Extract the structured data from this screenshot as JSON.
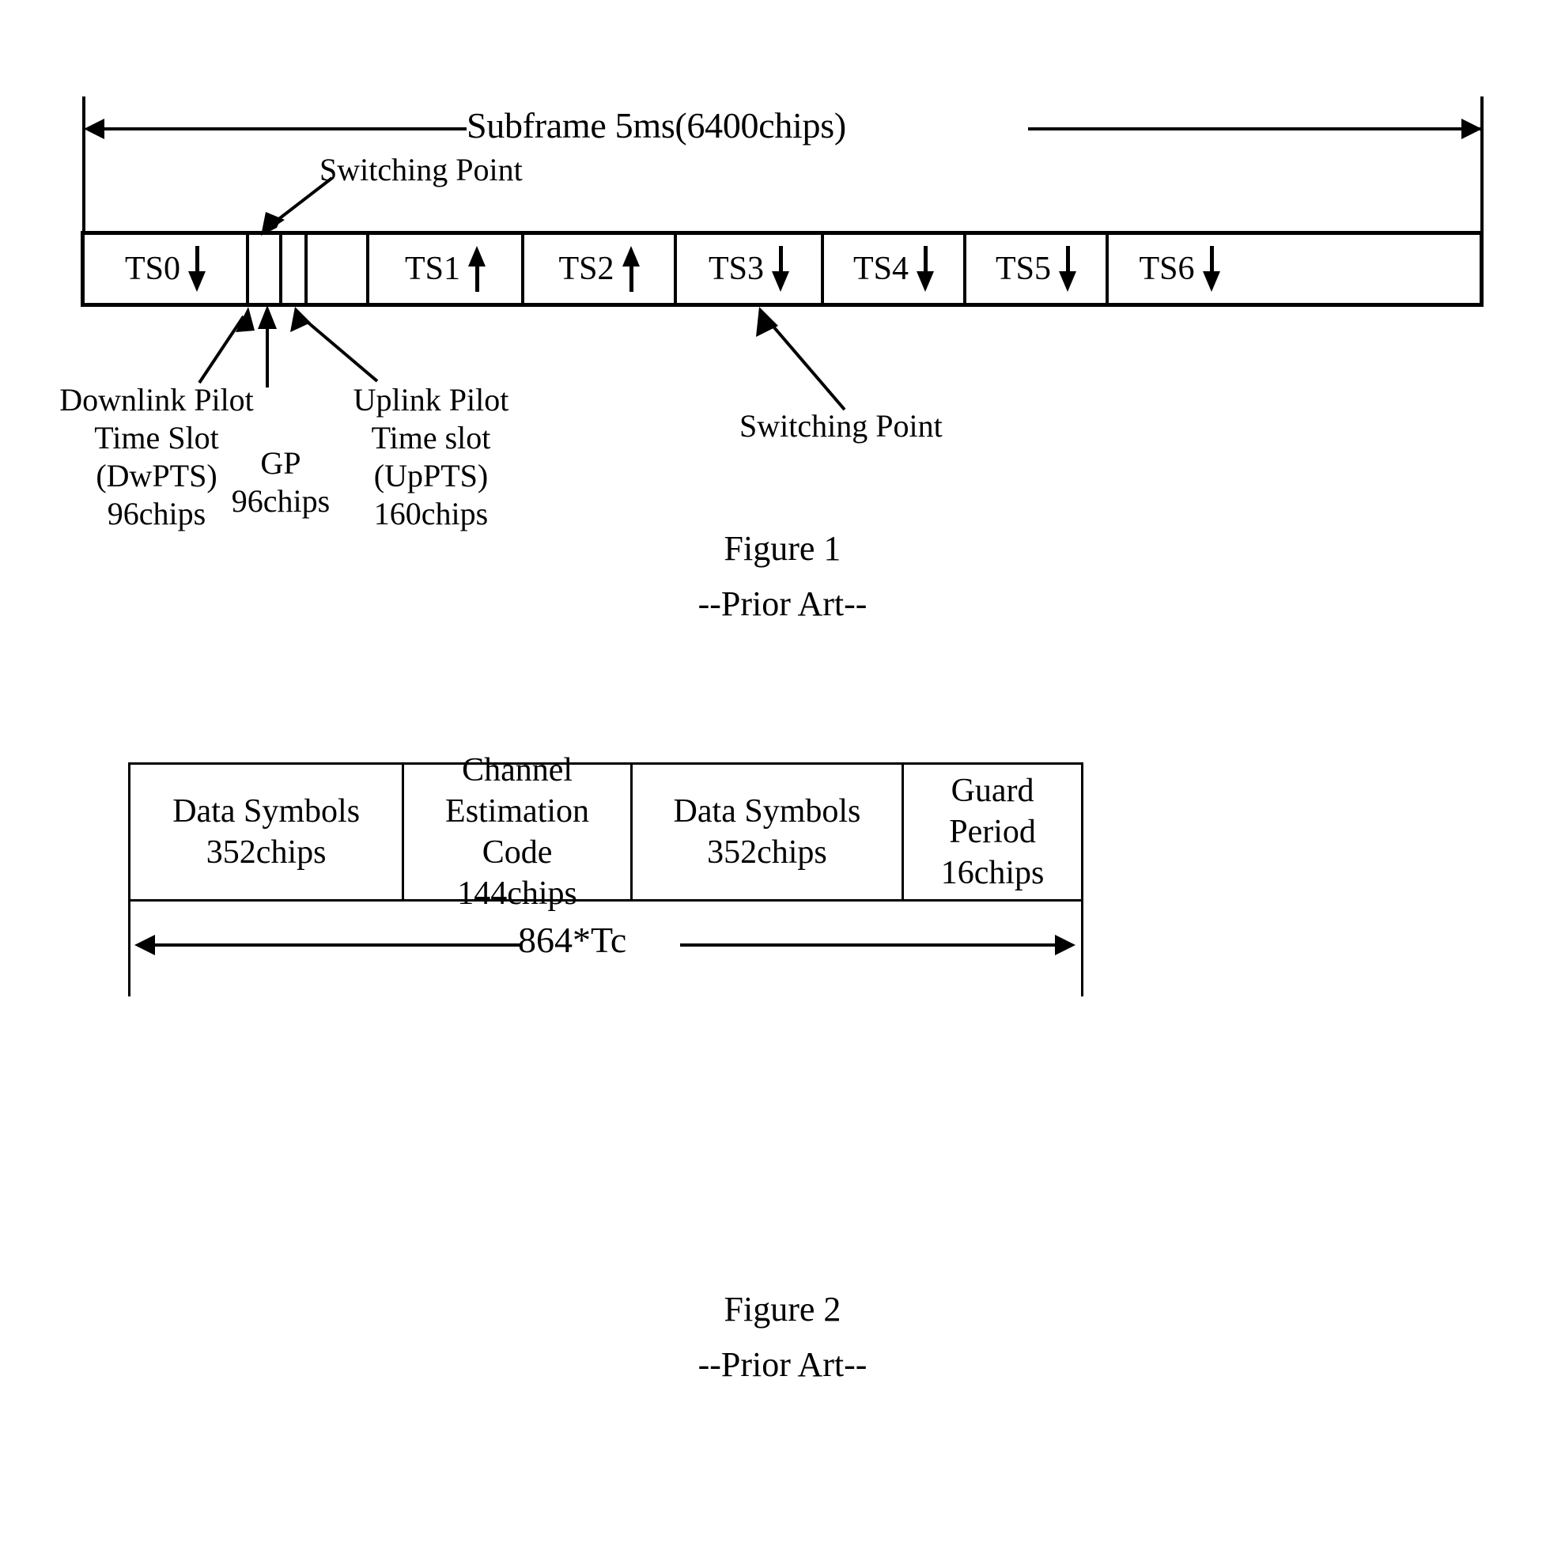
{
  "figure1": {
    "dimension_label": "Subframe 5ms(6400chips)",
    "switching_point_top": "Switching Point",
    "switching_point_bottom": "Switching Point",
    "timeslots": [
      {
        "label": "TS0",
        "direction": "down"
      },
      {
        "label": "",
        "direction": "none"
      },
      {
        "label": "",
        "direction": "none"
      },
      {
        "label": "",
        "direction": "none"
      },
      {
        "label": "TS1",
        "direction": "up"
      },
      {
        "label": "TS2",
        "direction": "up"
      },
      {
        "label": "TS3",
        "direction": "down"
      },
      {
        "label": "TS4",
        "direction": "down"
      },
      {
        "label": "TS5",
        "direction": "down"
      },
      {
        "label": "TS6",
        "direction": "down"
      }
    ],
    "dwpts_caption": "Downlink Pilot\nTime Slot\n(DwPTS)\n96chips",
    "gp_caption": "GP\n96chips",
    "uppts_caption": "Uplink Pilot\nTime slot\n(UpPTS)\n160chips",
    "caption": "Figure 1",
    "prior_art": "--Prior Art--"
  },
  "figure2": {
    "cells": [
      "Data Symbols\n352chips",
      "Channel\nEstimation Code\n144chips",
      "Data Symbols\n352chips",
      "Guard Period\n16chips"
    ],
    "dimension_label": "864*Tc",
    "caption": "Figure 2",
    "prior_art": "--Prior Art--"
  }
}
